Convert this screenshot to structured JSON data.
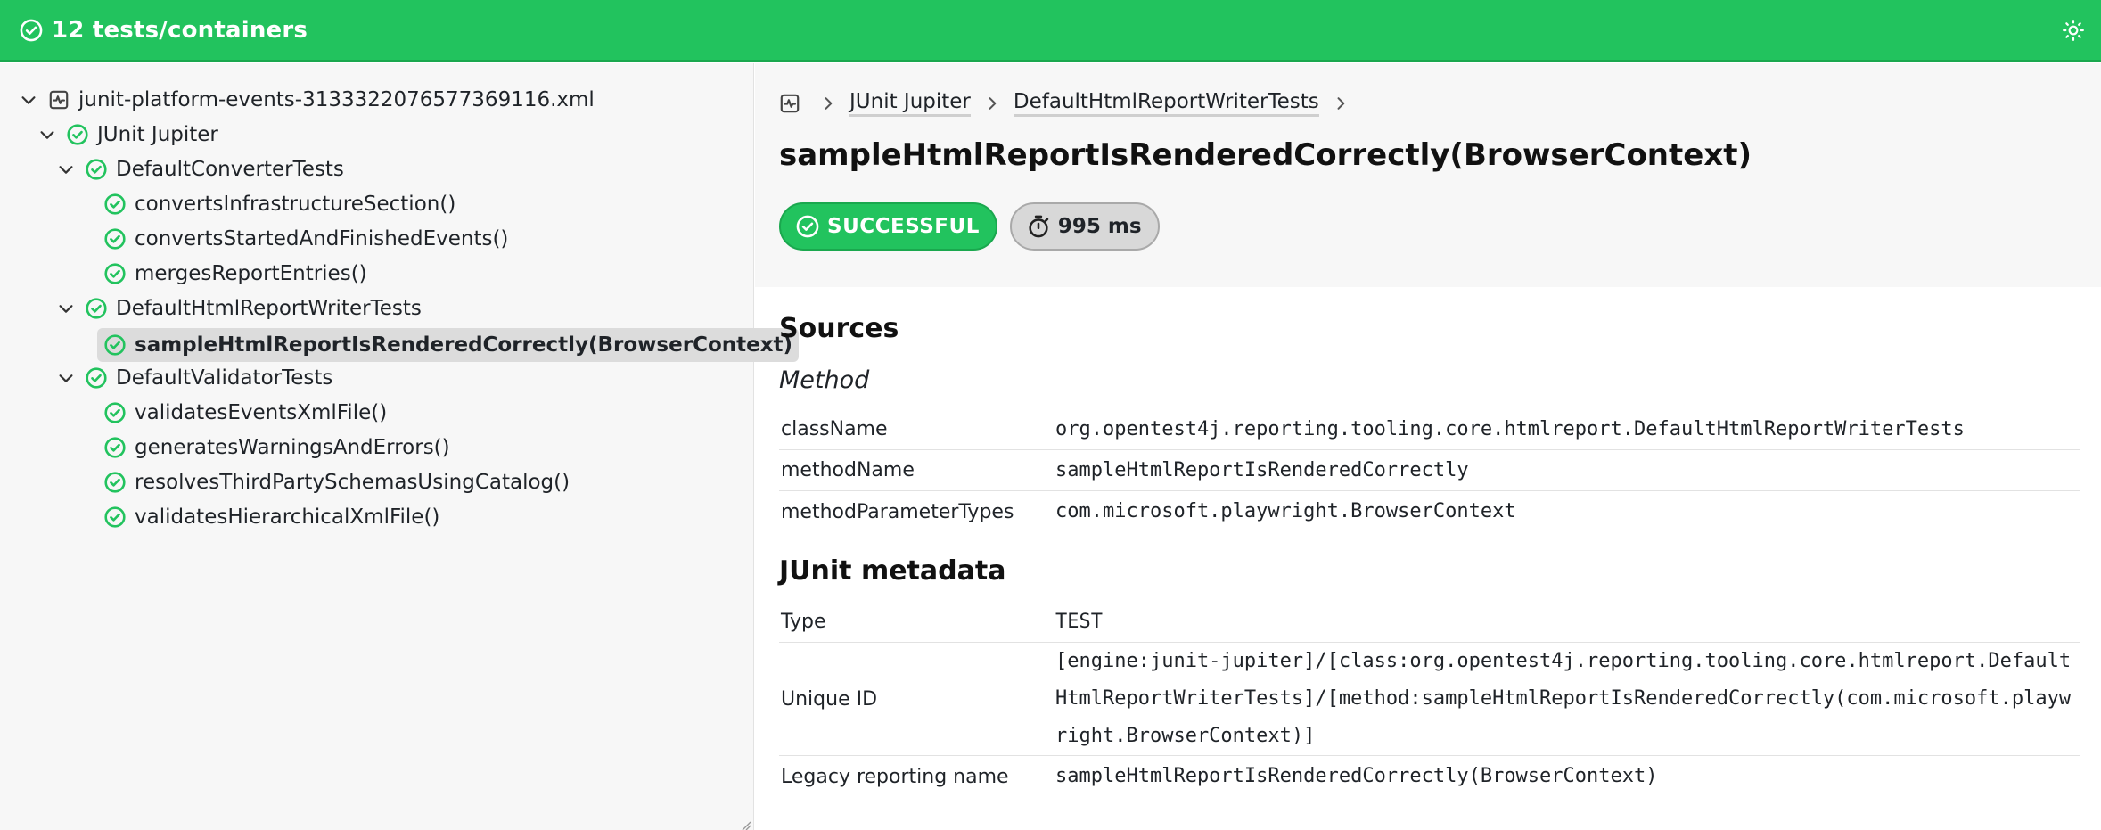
{
  "topbar": {
    "title": "12 tests/containers",
    "title_icon": "check-circle-icon",
    "theme_icon": "sun-icon"
  },
  "tree": {
    "root": {
      "label": "junit-platform-events-3133322076577369116.xml",
      "icon": "activity-file-icon"
    },
    "engine": {
      "label": "JUnit Jupiter",
      "status": "successful"
    },
    "classes": [
      {
        "label": "DefaultConverterTests",
        "methods": [
          "convertsInfrastructureSection()",
          "convertsStartedAndFinishedEvents()",
          "mergesReportEntries()"
        ]
      },
      {
        "label": "DefaultHtmlReportWriterTests",
        "methods": [
          "sampleHtmlReportIsRenderedCorrectly(BrowserContext)"
        ]
      },
      {
        "label": "DefaultValidatorTests",
        "methods": [
          "validatesEventsXmlFile()",
          "generatesWarningsAndErrors()",
          "resolvesThirdPartySchemasUsingCatalog()",
          "validatesHierarchicalXmlFile()"
        ]
      }
    ],
    "selected": "sampleHtmlReportIsRenderedCorrectly(BrowserContext)"
  },
  "breadcrumb": {
    "items": [
      "JUnit Jupiter",
      "DefaultHtmlReportWriterTests"
    ]
  },
  "detail": {
    "title": "sampleHtmlReportIsRenderedCorrectly(BrowserContext)",
    "status_label": "SUCCESSFUL",
    "duration_label": "995 ms"
  },
  "sources": {
    "heading": "Sources",
    "subheading": "Method",
    "rows": [
      {
        "key": "className",
        "value": "org.opentest4j.reporting.tooling.core.htmlreport.DefaultHtmlReportWriterTests"
      },
      {
        "key": "methodName",
        "value": "sampleHtmlReportIsRenderedCorrectly"
      },
      {
        "key": "methodParameterTypes",
        "value": "com.microsoft.playwright.BrowserContext"
      }
    ]
  },
  "metadata": {
    "heading": "JUnit metadata",
    "rows": [
      {
        "key": "Type",
        "value": "TEST"
      },
      {
        "key": "Unique ID",
        "value": "[engine:junit-jupiter]/[class:org.opentest4j.reporting.tooling.core.htmlreport.DefaultHtmlReportWriterTests]/[method:sampleHtmlReportIsRenderedCorrectly(com.microsoft.playwright.BrowserContext)]"
      },
      {
        "key": "Legacy reporting name",
        "value": "sampleHtmlReportIsRenderedCorrectly(BrowserContext)"
      }
    ]
  },
  "colors": {
    "accent_green": "#22c35e",
    "panel_bg": "#f7f7f7",
    "selected_bg": "#dcdcdc"
  }
}
